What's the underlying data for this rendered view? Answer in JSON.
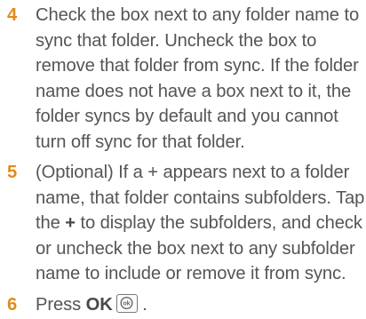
{
  "steps": [
    {
      "number": "4",
      "text": "Check the box next to any folder name to sync that folder. Uncheck the box to remove that folder from sync. If the folder name does not have a box next to it, the folder syncs by default and you cannot turn off sync for that folder."
    },
    {
      "number": "5",
      "text_before": "(Optional) If a + appears next to a folder name, that folder contains subfolders. Tap the ",
      "bold": "+",
      "text_after": " to display the subfolders, and check or uncheck the box next to any subfolder name to include or remove it from sync."
    },
    {
      "number": "6",
      "text_before": "Press ",
      "bold": "OK",
      "text_after": " .",
      "key_icon": "ok-key-icon",
      "key_label": "ok"
    }
  ],
  "colors": {
    "step_number": "#e08a1e",
    "body_text": "#555555"
  }
}
